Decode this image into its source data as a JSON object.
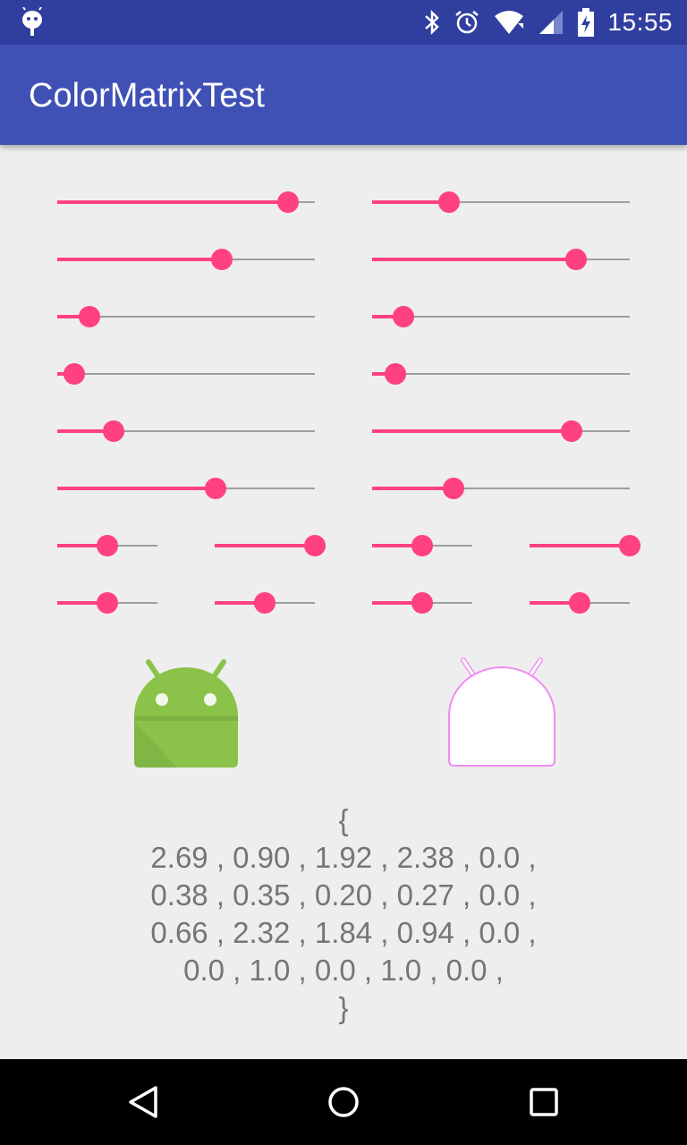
{
  "status_bar": {
    "time": "15:55",
    "icons": [
      "debug-icon",
      "bluetooth-icon",
      "alarm-icon",
      "wifi-icon",
      "cell-signal-icon",
      "battery-charging-icon"
    ]
  },
  "app_bar": {
    "title": "ColorMatrixTest"
  },
  "sliders": {
    "accent_color": "#FF4081",
    "left_column": [
      0.895,
      0.64,
      0.125,
      0.065,
      0.22,
      0.615
    ],
    "right_column": [
      0.3,
      0.79,
      0.12,
      0.09,
      0.775,
      0.315
    ],
    "small_row_1": [
      0.5,
      1.0,
      0.5,
      1.0
    ],
    "small_row_2": [
      0.5,
      0.5,
      0.5,
      0.5
    ]
  },
  "images": {
    "original": "android-robot-icon",
    "filtered": "android-robot-filtered-icon"
  },
  "matrix": {
    "open": "{",
    "row1": "2.69 , 0.90 , 1.92 , 2.38 , 0.0 ,",
    "row2": "0.38 , 0.35 , 0.20 , 0.27 , 0.0 ,",
    "row3": "0.66 , 2.32 , 1.84 , 0.94 , 0.0 ,",
    "row4": "0.0 , 1.0 , 0.0 , 1.0 , 0.0 ,",
    "close": "}"
  },
  "nav_bar": {
    "icons": [
      "back-icon",
      "home-icon",
      "recents-icon"
    ]
  }
}
